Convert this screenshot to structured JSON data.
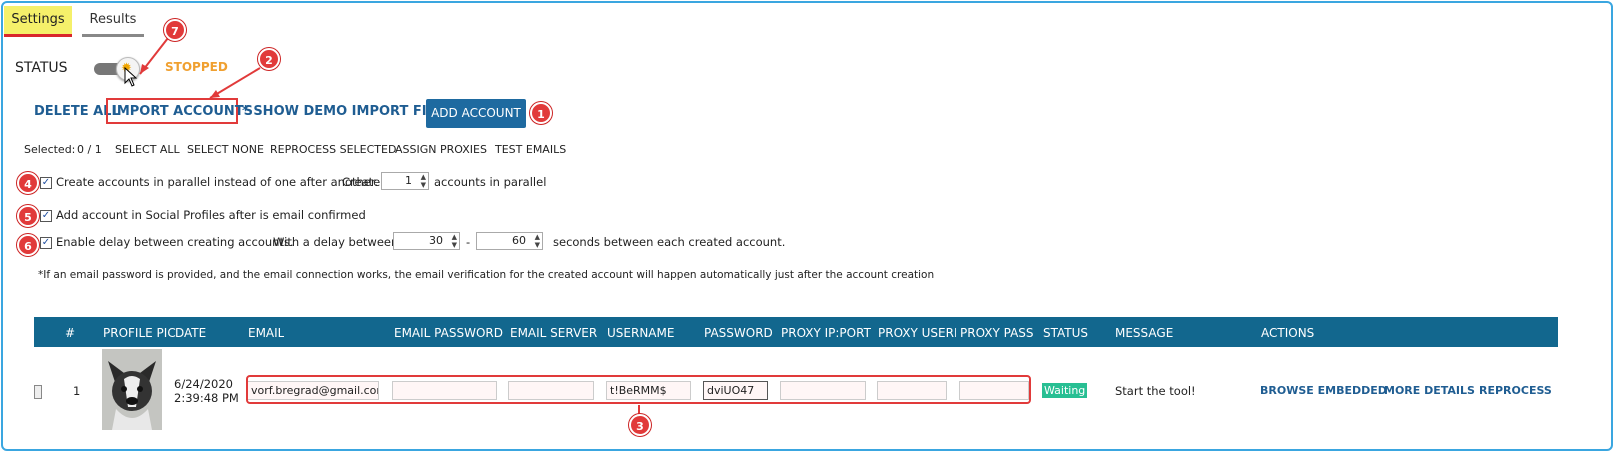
{
  "tabs": [
    {
      "label": "Settings"
    },
    {
      "label": "Results"
    }
  ],
  "status": {
    "label": "STATUS",
    "state": "STOPPED"
  },
  "toolbar": {
    "delete_all": "DELETE ALL",
    "import_accounts": "IMPORT ACCOUNTS",
    "show_demo": "* SHOW DEMO IMPORT FILE",
    "add_account": "ADD ACCOUNT"
  },
  "selection": {
    "label": "Selected:",
    "count": "0 / 1",
    "links": [
      "SELECT ALL",
      "SELECT NONE",
      "REPROCESS SELECTED",
      "ASSIGN PROXIES",
      "TEST EMAILS"
    ]
  },
  "options": {
    "parallel": {
      "text": "Create accounts in parallel instead of one after another.",
      "create": "Create",
      "value": "1",
      "suffix": "accounts in parallel"
    },
    "social": {
      "text": "Add account in Social Profiles after is email confirmed"
    },
    "delay": {
      "text": "Enable delay between creating accounts.",
      "with": "With a delay between",
      "min": "30",
      "dash": "-",
      "max": "60",
      "suffix": "seconds between each created account."
    }
  },
  "footnote": "*If an email password is provided, and the email connection works, the email verification for the created account will happen automatically just after the account creation",
  "table": {
    "headers": [
      "#",
      "PROFILE PIC",
      "DATE",
      "EMAIL",
      "EMAIL PASSWORD",
      "EMAIL SERVER",
      "USERNAME",
      "PASSWORD",
      "PROXY IP:PORT",
      "PROXY USERNAME",
      "PROXY PASS",
      "STATUS",
      "MESSAGE",
      "ACTIONS"
    ],
    "rows": [
      {
        "num": "1",
        "date": "6/24/2020",
        "time": "2:39:48 PM",
        "email": "vorf.bregrad@gmail.com",
        "email_password": "",
        "email_server": "",
        "username": "t!BeRMM$",
        "password": "dviUO47",
        "proxy_ip": "",
        "proxy_user": "",
        "proxy_pass": "",
        "status": "Waiting",
        "message": "Start the tool!",
        "actions": [
          "BROWSE EMBEDDED",
          "MORE DETAILS",
          "REPROCESS"
        ]
      }
    ]
  },
  "annotations": [
    "1",
    "2",
    "3",
    "4",
    "5",
    "6",
    "7"
  ],
  "colors": {
    "accent": "#12678e",
    "link": "#1f5d92",
    "stopped": "#f0a030",
    "annotation": "#e13a3a",
    "waiting": "#28bf93",
    "tab_highlight": "#f5f06a"
  }
}
